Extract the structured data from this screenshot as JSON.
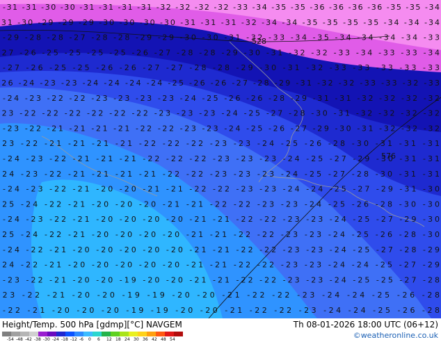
{
  "header": {
    "title": "Height/Temp. 500 hPa [gdmp][°C] NAVGEM",
    "valid_time": "Th 08-01-2026 18:00 UTC (06+12)",
    "credit": "©weatheronline.co.uk"
  },
  "legend": {
    "ticks": [
      "-54",
      "-48",
      "-42",
      "-38",
      "-30",
      "-24",
      "-18",
      "-12",
      "-6",
      "0",
      "6",
      "12",
      "18",
      "24",
      "30",
      "36",
      "42",
      "48",
      "54"
    ],
    "colors": [
      "#7f7f7f",
      "#a0a0a0",
      "#b5b5b5",
      "#d0d0d0",
      "#9a1fd0",
      "#6a0bbf",
      "#1f28d0",
      "#0b53ff",
      "#2d8bff",
      "#3cbcff",
      "#2ad6cf",
      "#24b34b",
      "#5ed120",
      "#a9e41a",
      "#e9f01f",
      "#ffd21a",
      "#ffa010",
      "#ff5a12",
      "#e11818",
      "#b20d0d"
    ]
  },
  "map": {
    "contour_labels": [
      "528",
      "576"
    ],
    "temperature_rows": [
      "-31 -31 -30 -30 -31 -31 -31 -31 -32 -32 -32 -32 -33 -34 -35 -35 -36 -36 -36 -36 -35 -35 -34",
      "-31 -30 -29 -29 -29 -30 -30 -30 -30 -31 -31 -31 -32 -34 -34 -35 -35 -35 -35 -34 -34 -34",
      "-29 -28 -28 -27 -28 -28 -29 -29 -30 -30 -31 -32 -33 -34 -35 -34 -34 -34 -34 -33",
      "-27 -26 -25 -25 -25 -25 -26 -27 -28 -28 -29 -30 -31 -32 -32 -33 -34 -33 -33 -34",
      "-27 -26 -25 -25 -26 -26 -27 -27 -28 -28 -29 -30 -31 -32 -33 -33 -33 -33 -33",
      "-26 -24 -23 -23 -24 -24 -24 -24 -25 -26 -26 -27 -28 -29 -31 -32 -32 -33 -33 -32 -33",
      "-24 -23 -22 -22 -23 -23 -23 -23 -24 -25 -26 -26 -28 -29 -31 -31 -32 -32 -32 -32",
      "-23 -22 -22 -22 -22 -22 -22 -23 -23 -23 -24 -25 -27 -28 -30 -31 -32 -32 -32 -32",
      "-23 -22 -21 -21 -21 -21 -22 -22 -23 -23 -24 -25 -26 -27 -29 -30 -31 -32 -32 -32",
      "-23 -22 -21 -21 -21 -21 -22 -22 -22 -23 -23 -24 -25 -26 -28 -30 -31 -31 -31",
      "-24 -23 -22 -21 -21 -21 -22 -22 -22 -23 -23 -23 -24 -25 -27 -29 -30 -31 -31",
      "-24 -23 -22 -21 -21 -21 -21 -22 -22 -23 -23 -23 -24 -25 -27 -28 -30 -31 -31",
      "-24 -23 -22 -21 -20 -20 -21 -21 -22 -22 -23 -23 -24 -24 -25 -27 -29 -31 -30",
      "-25 -24 -22 -21 -20 -20 -20 -21 -21 -22 -22 -23 -23 -24 -25 -26 -28 -30 -30",
      "-24 -23 -22 -21 -20 -20 -20 -20 -21 -21 -22 -22 -23 -23 -24 -25 -27 -29 -30",
      "-25 -24 -22 -21 -20 -20 -20 -20 -21 -21 -22 -22 -23 -23 -24 -25 -26 -28 -30",
      "-24 -22 -21 -20 -20 -20 -20 -20 -21 -21 -22 -22 -23 -23 -24 -25 -27 -28 -29",
      "-24 -22 -21 -20 -20 -20 -20 -20 -21 -21 -22 -22 -23 -23 -24 -24 -25 -27 -29",
      "-23 -22 -21 -20 -20 -19 -20 -20 -21 -21 -22 -22 -23 -23 -24 -25 -25 -27 -28",
      "-23 -22 -21 -20 -20 -19 -19 -20 -20 -21 -22 -22 -23 -24 -24 -25 -26 -28",
      "-22 -21 -20 -20 -20 -19 -19 -20 -20 -21 -22 -22 -23 -24 -24 -25 -26 -28",
      "-22 -21 -20 -20 -20 -19 -19 -19 -20 -21 -21 -22 -23 -23 -24 -25 -25 -26"
    ]
  }
}
